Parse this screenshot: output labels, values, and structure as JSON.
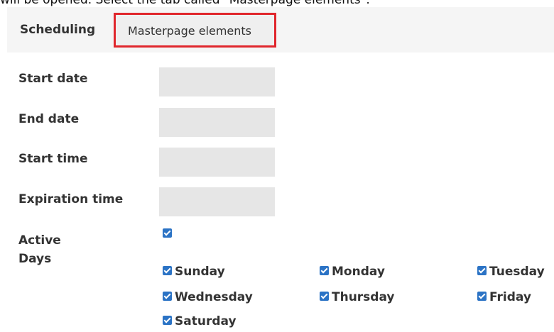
{
  "instruction": "will be opened. Select the tab called \"Masterpage elements\".",
  "tabs": {
    "scheduling": "Scheduling",
    "masterpage": "Masterpage elements"
  },
  "form": {
    "start_date_label": "Start date",
    "end_date_label": "End date",
    "start_time_label": "Start time",
    "expiration_time_label": "Expiration time",
    "active_label": "Active",
    "days_label": "Days"
  },
  "days": [
    {
      "label": "Sunday",
      "checked": true
    },
    {
      "label": "Monday",
      "checked": true
    },
    {
      "label": "Tuesday",
      "checked": true
    },
    {
      "label": "Wednesday",
      "checked": true
    },
    {
      "label": "Thursday",
      "checked": true
    },
    {
      "label": "Friday",
      "checked": true
    },
    {
      "label": "Saturday",
      "checked": true
    }
  ],
  "colors": {
    "highlight": "#e0262c",
    "checkbox": "#2b73c5",
    "field_bg": "#e6e6e6",
    "tabbar_bg": "#f5f5f5"
  }
}
